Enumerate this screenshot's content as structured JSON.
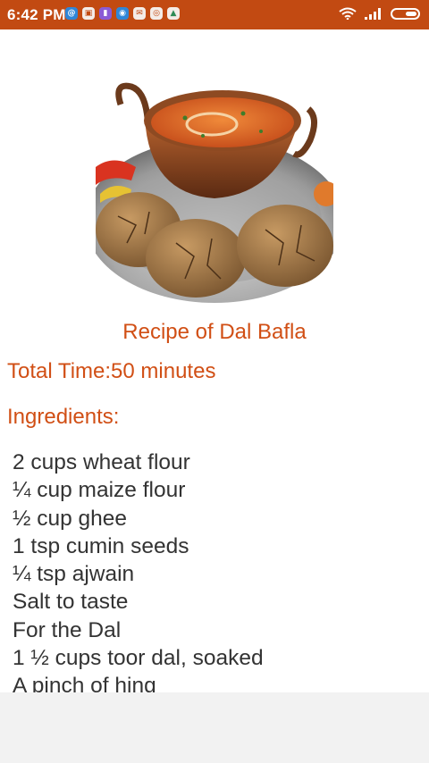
{
  "status_bar": {
    "time": "6:42 PM",
    "notification_icons": [
      "app-icon",
      "app-icon",
      "app-icon",
      "app-icon",
      "mail-icon",
      "app-icon",
      "app-icon"
    ],
    "system_icons": [
      "wifi-icon",
      "signal-icon",
      "battery-icon"
    ],
    "colors": {
      "background": "#c24a12",
      "foreground": "#ffffff"
    }
  },
  "recipe": {
    "title": "Recipe of Dal Bafla",
    "total_time": "Total Time:50 minutes",
    "ingredients_heading": "Ingredients:",
    "ingredients": [
      "2 cups wheat flour",
      "¼ cup maize flour",
      "½ cup ghee",
      "1 tsp cumin seeds",
      "¼ tsp ajwain",
      "Salt to taste",
      "For the Dal",
      "1 ½ cups toor dal, soaked",
      "A pinch of hing"
    ],
    "colors": {
      "accent": "#d14f15",
      "body_text": "#333333"
    }
  }
}
